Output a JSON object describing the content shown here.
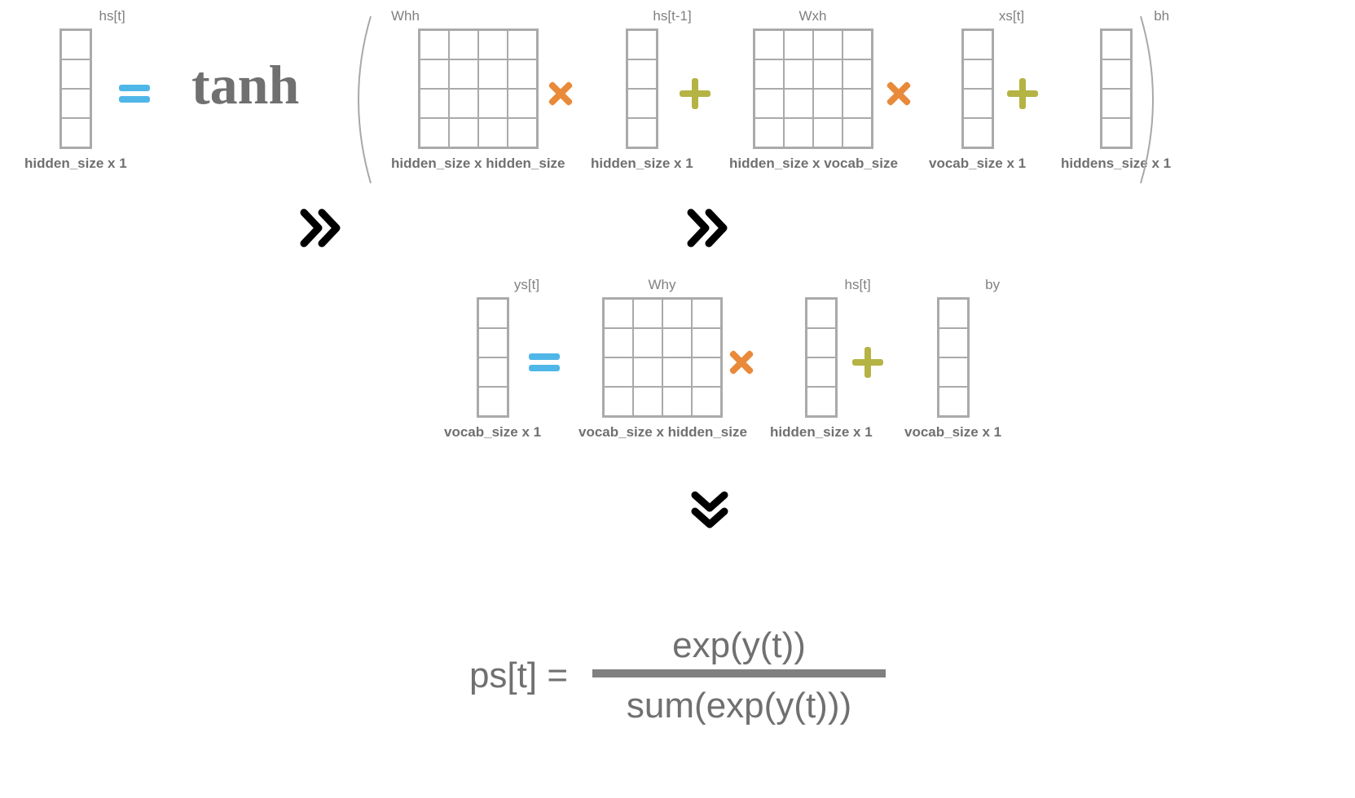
{
  "row1": {
    "hs_t": {
      "top": "hs[t]",
      "dim": "hidden_size x 1"
    },
    "tanh": "tanh",
    "whh": {
      "top": "Whh",
      "dim": "hidden_size x hidden_size"
    },
    "hs_tm1": {
      "top": "hs[t-1]",
      "dim": "hidden_size x 1"
    },
    "wxh": {
      "top": "Wxh",
      "dim": "hidden_size x vocab_size"
    },
    "xs_t": {
      "top": "xs[t]",
      "dim": "vocab_size x 1"
    },
    "bh": {
      "top": "bh",
      "dim": "hiddens_size x 1"
    }
  },
  "row2": {
    "ys_t": {
      "top": "ys[t]",
      "dim": "vocab_size x 1"
    },
    "why": {
      "top": "Why",
      "dim": "vocab_size x hidden_size"
    },
    "hs_t": {
      "top": "hs[t]",
      "dim": "hidden_size x 1"
    },
    "by": {
      "top": "by",
      "dim": "vocab_size x 1"
    }
  },
  "softmax": {
    "lhs": "ps[t] =",
    "num": "exp(y(t))",
    "den": "sum(exp(y(t)))"
  }
}
